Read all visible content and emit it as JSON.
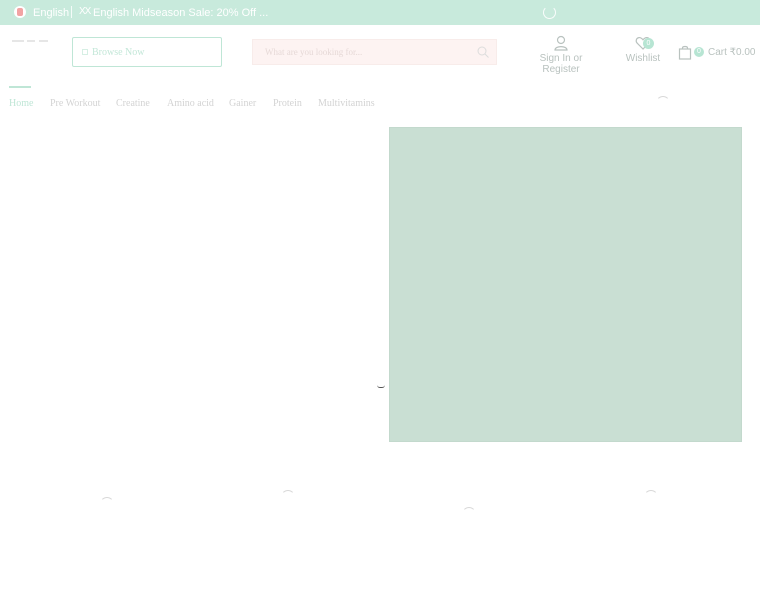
{
  "topbar": {
    "language": "English",
    "promo_icon": "XX",
    "promo_text": "English Midseason Sale: 20% Off ..."
  },
  "header": {
    "browse_label": "Browse Now",
    "search_placeholder": "What are you looking for...",
    "account_label": "Sign In or Register",
    "wishlist_label": "Wishlist",
    "wishlist_count": "0",
    "cart_count": "0",
    "cart_label": "Cart ₹0.00"
  },
  "nav": {
    "items": [
      {
        "label": "Home"
      },
      {
        "label": "Pre Workout"
      },
      {
        "label": "Creatine"
      },
      {
        "label": "Amino acid"
      },
      {
        "label": "Gainer"
      },
      {
        "label": "Protein"
      },
      {
        "label": "Multivitamins"
      }
    ]
  },
  "colors": {
    "topbar_bg": "#c8eadc",
    "accent": "#bfe6d6",
    "hero_bg": "#c9dfd3",
    "search_bg": "#fdf3f2"
  }
}
